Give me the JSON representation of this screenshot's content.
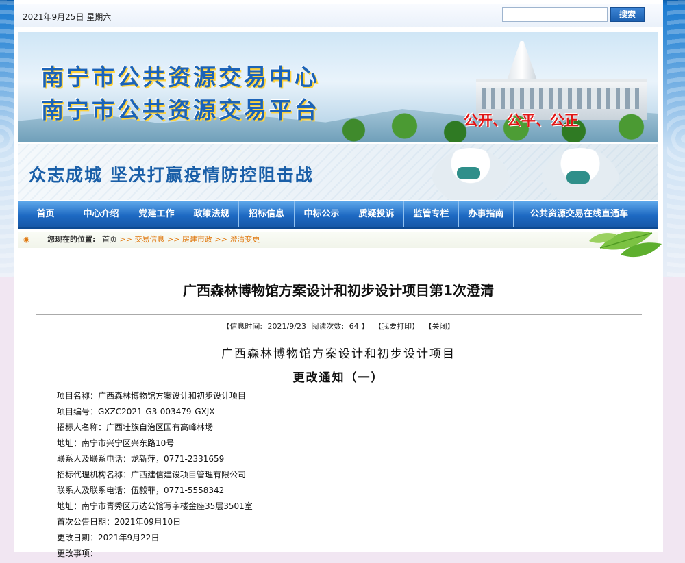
{
  "topbar": {
    "date": "2021年9月25日 星期六",
    "search_placeholder": "",
    "search_button": "搜索"
  },
  "banner": {
    "title_line1": "南宁市公共资源交易中心",
    "title_line2": "南宁市公共资源交易平台",
    "slogan": "公开、公平、公正"
  },
  "banner2": {
    "text": "众志成城    坚决打赢疫情防控阻击战"
  },
  "nav": {
    "items": [
      {
        "label": "首页"
      },
      {
        "label": "中心介绍"
      },
      {
        "label": "党建工作"
      },
      {
        "label": "政策法规"
      },
      {
        "label": "招标信息"
      },
      {
        "label": "中标公示"
      },
      {
        "label": "质疑投诉"
      },
      {
        "label": "监管专栏"
      },
      {
        "label": "办事指南"
      },
      {
        "label": "公共资源交易在线直通车"
      }
    ]
  },
  "breadcrumb": {
    "bullet": "◉",
    "label": "您现在的位置:",
    "home": "首页",
    "sep": ">>",
    "items": [
      "交易信息",
      "房建市政",
      "澄清变更"
    ]
  },
  "article": {
    "title": "广西森林博物馆方案设计和初步设计项目第1次澄清",
    "meta": {
      "time_label": "【信息时间:",
      "time_value": "2021/9/23",
      "reads_label": "阅读次数:",
      "reads_value": "64",
      "close_bracket": "】",
      "print": "【我要打印】",
      "close": "【关闭】"
    },
    "heading1": "广西森林博物馆方案设计和初步设计项目",
    "heading2": "更改通知（一）",
    "details": [
      "项目名称：广西森林博物馆方案设计和初步设计项目",
      "项目编号：GXZC2021-G3-003479-GXJX",
      "招标人名称：广西壮族自治区国有高峰林场",
      "地址：南宁市兴宁区兴东路10号",
      "联系人及联系电话：龙新萍，0771-2331659",
      "招标代理机构名称：广西建信建设项目管理有限公司",
      "联系人及联系电话：伍毅菲，0771-5558342",
      "地址：南宁市青秀区万达公馆写字楼金座35层3501室",
      "首次公告日期：2021年09月10日",
      "更改日期：2021年9月22日",
      "更改事项："
    ]
  },
  "colors": {
    "nav_blue": "#1d69c2",
    "banner_title_blue": "#1b63b8",
    "slogan_red": "#e01515",
    "breadcrumb_orange": "#e07a12"
  }
}
